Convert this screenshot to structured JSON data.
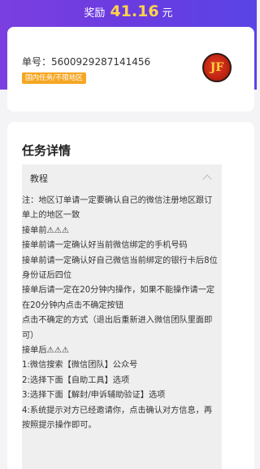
{
  "header": {
    "reward_label": "奖励",
    "reward_amount": "41.16",
    "reward_unit": "元"
  },
  "order": {
    "number_text": "单号：5600929287141456",
    "tag": "国内任务/不限地区",
    "avatar_text": "JF"
  },
  "details": {
    "title": "任务详情",
    "accordion_title": "教程",
    "lines": [
      "注：地区订单请一定要确认自己的微信注册地区跟订单上的地区一致",
      "接单前⚠⚠⚠",
      "接单前请一定确认好当前微信绑定的手机号码",
      "接单前请一定确认好自己微信当前绑定的银行卡后8位身份证后四位",
      "接单后请一定在20分钟内操作，如果不能操作请一定在20分钟内点击不确定按钮",
      "点击不确定的方式（退出后重新进入微信团队里面即可）",
      "接单后⚠⚠⚠",
      "1:微信搜索【微信团队】公众号",
      "2:选择下面【自助工具】选项",
      "3:选择下面【解封/申诉辅助验证】选项",
      "4:系统提示对方已经邀请你，点击确认对方信息，再按照提示操作即可。"
    ]
  }
}
